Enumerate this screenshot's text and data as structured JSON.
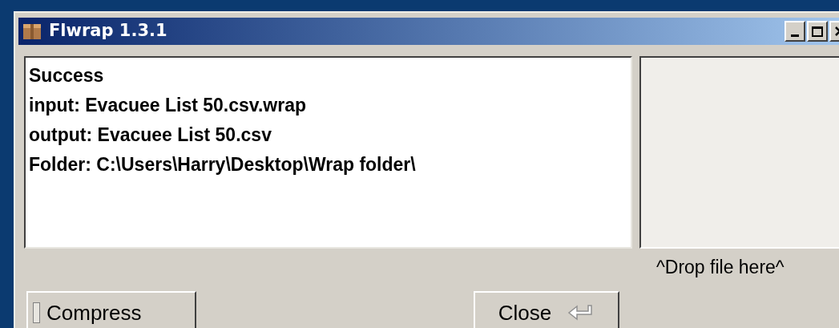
{
  "window": {
    "title": "Flwrap 1.3.1"
  },
  "log": [
    "Success",
    "input: Evacuee List 50.csv.wrap",
    "output: Evacuee List 50.csv",
    "Folder: C:\\Users\\Harry\\Desktop\\Wrap folder\\"
  ],
  "compress_button": {
    "label": "Compress",
    "checked": false
  },
  "close_button": {
    "label": "Close"
  },
  "drop_zone": {
    "label": "^Drop file here^"
  }
}
